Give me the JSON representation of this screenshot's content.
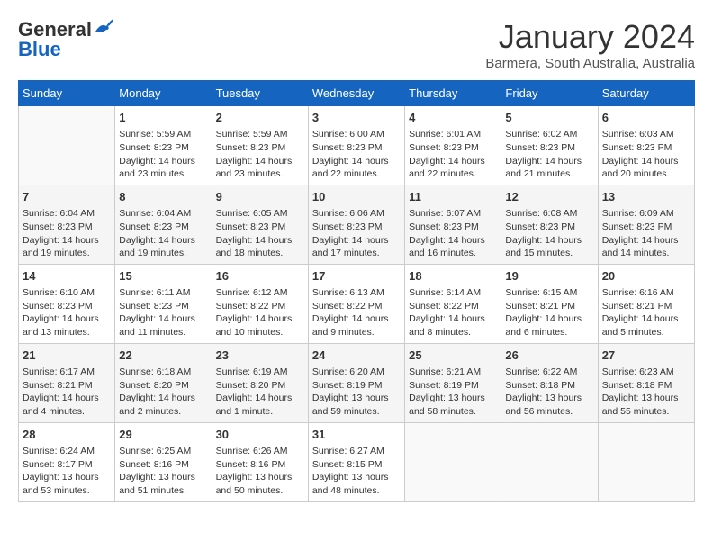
{
  "header": {
    "logo_line1": "General",
    "logo_line2": "Blue",
    "month_title": "January 2024",
    "subtitle": "Barmera, South Australia, Australia"
  },
  "days_of_week": [
    "Sunday",
    "Monday",
    "Tuesday",
    "Wednesday",
    "Thursday",
    "Friday",
    "Saturday"
  ],
  "weeks": [
    [
      {
        "day": "",
        "info": ""
      },
      {
        "day": "1",
        "info": "Sunrise: 5:59 AM\nSunset: 8:23 PM\nDaylight: 14 hours\nand 23 minutes."
      },
      {
        "day": "2",
        "info": "Sunrise: 5:59 AM\nSunset: 8:23 PM\nDaylight: 14 hours\nand 23 minutes."
      },
      {
        "day": "3",
        "info": "Sunrise: 6:00 AM\nSunset: 8:23 PM\nDaylight: 14 hours\nand 22 minutes."
      },
      {
        "day": "4",
        "info": "Sunrise: 6:01 AM\nSunset: 8:23 PM\nDaylight: 14 hours\nand 22 minutes."
      },
      {
        "day": "5",
        "info": "Sunrise: 6:02 AM\nSunset: 8:23 PM\nDaylight: 14 hours\nand 21 minutes."
      },
      {
        "day": "6",
        "info": "Sunrise: 6:03 AM\nSunset: 8:23 PM\nDaylight: 14 hours\nand 20 minutes."
      }
    ],
    [
      {
        "day": "7",
        "info": "Sunrise: 6:04 AM\nSunset: 8:23 PM\nDaylight: 14 hours\nand 19 minutes."
      },
      {
        "day": "8",
        "info": "Sunrise: 6:04 AM\nSunset: 8:23 PM\nDaylight: 14 hours\nand 19 minutes."
      },
      {
        "day": "9",
        "info": "Sunrise: 6:05 AM\nSunset: 8:23 PM\nDaylight: 14 hours\nand 18 minutes."
      },
      {
        "day": "10",
        "info": "Sunrise: 6:06 AM\nSunset: 8:23 PM\nDaylight: 14 hours\nand 17 minutes."
      },
      {
        "day": "11",
        "info": "Sunrise: 6:07 AM\nSunset: 8:23 PM\nDaylight: 14 hours\nand 16 minutes."
      },
      {
        "day": "12",
        "info": "Sunrise: 6:08 AM\nSunset: 8:23 PM\nDaylight: 14 hours\nand 15 minutes."
      },
      {
        "day": "13",
        "info": "Sunrise: 6:09 AM\nSunset: 8:23 PM\nDaylight: 14 hours\nand 14 minutes."
      }
    ],
    [
      {
        "day": "14",
        "info": "Sunrise: 6:10 AM\nSunset: 8:23 PM\nDaylight: 14 hours\nand 13 minutes."
      },
      {
        "day": "15",
        "info": "Sunrise: 6:11 AM\nSunset: 8:23 PM\nDaylight: 14 hours\nand 11 minutes."
      },
      {
        "day": "16",
        "info": "Sunrise: 6:12 AM\nSunset: 8:22 PM\nDaylight: 14 hours\nand 10 minutes."
      },
      {
        "day": "17",
        "info": "Sunrise: 6:13 AM\nSunset: 8:22 PM\nDaylight: 14 hours\nand 9 minutes."
      },
      {
        "day": "18",
        "info": "Sunrise: 6:14 AM\nSunset: 8:22 PM\nDaylight: 14 hours\nand 8 minutes."
      },
      {
        "day": "19",
        "info": "Sunrise: 6:15 AM\nSunset: 8:21 PM\nDaylight: 14 hours\nand 6 minutes."
      },
      {
        "day": "20",
        "info": "Sunrise: 6:16 AM\nSunset: 8:21 PM\nDaylight: 14 hours\nand 5 minutes."
      }
    ],
    [
      {
        "day": "21",
        "info": "Sunrise: 6:17 AM\nSunset: 8:21 PM\nDaylight: 14 hours\nand 4 minutes."
      },
      {
        "day": "22",
        "info": "Sunrise: 6:18 AM\nSunset: 8:20 PM\nDaylight: 14 hours\nand 2 minutes."
      },
      {
        "day": "23",
        "info": "Sunrise: 6:19 AM\nSunset: 8:20 PM\nDaylight: 14 hours\nand 1 minute."
      },
      {
        "day": "24",
        "info": "Sunrise: 6:20 AM\nSunset: 8:19 PM\nDaylight: 13 hours\nand 59 minutes."
      },
      {
        "day": "25",
        "info": "Sunrise: 6:21 AM\nSunset: 8:19 PM\nDaylight: 13 hours\nand 58 minutes."
      },
      {
        "day": "26",
        "info": "Sunrise: 6:22 AM\nSunset: 8:18 PM\nDaylight: 13 hours\nand 56 minutes."
      },
      {
        "day": "27",
        "info": "Sunrise: 6:23 AM\nSunset: 8:18 PM\nDaylight: 13 hours\nand 55 minutes."
      }
    ],
    [
      {
        "day": "28",
        "info": "Sunrise: 6:24 AM\nSunset: 8:17 PM\nDaylight: 13 hours\nand 53 minutes."
      },
      {
        "day": "29",
        "info": "Sunrise: 6:25 AM\nSunset: 8:16 PM\nDaylight: 13 hours\nand 51 minutes."
      },
      {
        "day": "30",
        "info": "Sunrise: 6:26 AM\nSunset: 8:16 PM\nDaylight: 13 hours\nand 50 minutes."
      },
      {
        "day": "31",
        "info": "Sunrise: 6:27 AM\nSunset: 8:15 PM\nDaylight: 13 hours\nand 48 minutes."
      },
      {
        "day": "",
        "info": ""
      },
      {
        "day": "",
        "info": ""
      },
      {
        "day": "",
        "info": ""
      }
    ]
  ]
}
